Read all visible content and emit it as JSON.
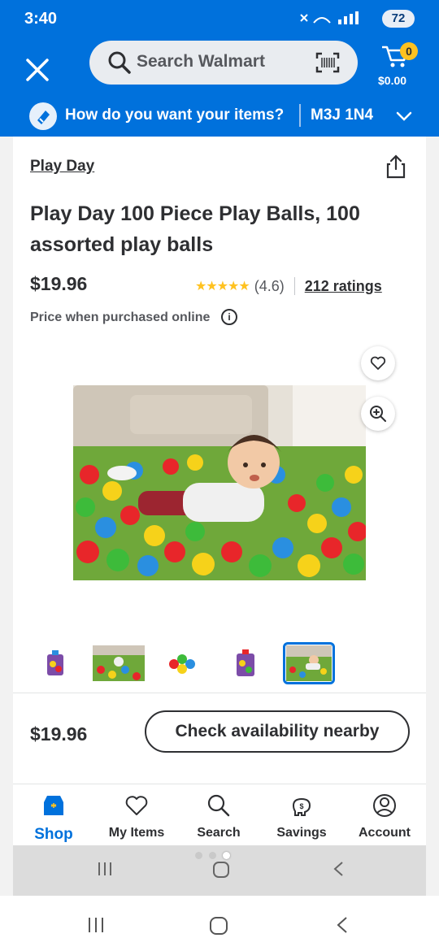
{
  "status_bar": {
    "time": "3:40",
    "battery": "72",
    "icons": [
      "mute-icon",
      "wifi-icon",
      "signal-icon"
    ]
  },
  "header": {
    "search_placeholder": "Search Walmart",
    "cart_count": "0",
    "cart_total": "$0.00",
    "delivery_prompt": "How do you want your items?",
    "postal_code": "M3J 1N4",
    "brand_color": "#0071dc",
    "badge_color": "#ffc220"
  },
  "product": {
    "brand": "Play Day",
    "title": "Play Day 100 Piece Play Balls, 100 assorted play balls",
    "price": "$19.96",
    "stars": "★★★★★",
    "rating_value": "(4.6)",
    "rating_count": "212 ratings",
    "price_note": "Price when purchased online",
    "info_glyph": "i"
  },
  "gallery": {
    "thumbnail_count": 5,
    "selected_index": 4
  },
  "footer": {
    "price": "$19.96",
    "check_button": "Check availability nearby"
  },
  "bottom_nav": {
    "items": [
      {
        "label": "Shop",
        "icon": "store-icon",
        "active": true
      },
      {
        "label": "My Items",
        "icon": "heart-icon",
        "active": false
      },
      {
        "label": "Search",
        "icon": "search-icon",
        "active": false
      },
      {
        "label": "Savings",
        "icon": "piggy-bank-icon",
        "active": false
      },
      {
        "label": "Account",
        "icon": "account-icon",
        "active": false
      }
    ]
  }
}
